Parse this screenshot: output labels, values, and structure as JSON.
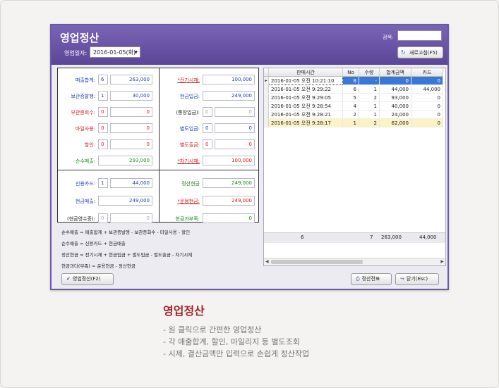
{
  "window": {
    "title": "영업정산",
    "date_label": "영업일자:",
    "date_value": "2016-01-05(화)",
    "search_label": "검색:",
    "search_value": "",
    "refresh_button": "새로고침(F5)"
  },
  "settle": {
    "sales_total": {
      "label": "매출합계:",
      "count": "6",
      "amount": "263,000"
    },
    "refund": {
      "label": "보관증발행:",
      "count": "1",
      "amount": "30,000"
    },
    "receivable": {
      "label": "부관증회수:",
      "count": "0",
      "amount": "0"
    },
    "mileage": {
      "label": "마일사용:",
      "count": "0",
      "amount": "0"
    },
    "discount": {
      "label": "할인:",
      "count": "0",
      "amount": "0"
    },
    "net_sales": {
      "label": "순수매출:",
      "amount": "293,000"
    },
    "prev_cash": {
      "label": "*전기시재:",
      "amount": "100,000"
    },
    "cash_in": {
      "label": "현금입금:",
      "amount": "249,000"
    },
    "exchange_in": {
      "label": "(통장입금):",
      "count": "0",
      "amount": "0"
    },
    "extra_in": {
      "label": "별도입금:",
      "count": "0",
      "amount": "0"
    },
    "extra_out": {
      "label": "별도출금:",
      "count": "0",
      "amount": "0"
    },
    "next_cash": {
      "label": "*차기시재:",
      "amount": "100,000"
    },
    "card": {
      "label": "신용카드:",
      "count": "1",
      "amount": "44,000"
    },
    "cash_sales": {
      "label": "현금매출:",
      "amount": "249,000"
    },
    "cash_receipt": {
      "label": "(현금영수증):",
      "count": "0",
      "amount": "0"
    },
    "settle_cash": {
      "label": "정산현금",
      "amount": "249,000"
    },
    "flow_cash": {
      "label": "*운용현금:",
      "amount": "249,000"
    },
    "cash_diff": {
      "label": "현금과부족:",
      "amount": "0"
    }
  },
  "formulas": [
    "순수매출 = 매출합계 + 보관증발행 - 보관증회수 - 마일사용 - 할인",
    "순수매출 = 신용카드 + 현금매출",
    "정산현금 = 전기시재 + 현금입금 + 별도입금 - 별도출금 - 차기시재",
    "현금과다(부족) = 운용현금 - 정산현금"
  ],
  "grid": {
    "columns": [
      "판매시간",
      "No",
      "수량",
      "합계금액",
      "카드"
    ],
    "rows": [
      {
        "time": "2016-01-05 오전 10:21:10",
        "no": "8",
        "qty": "-",
        "total": "0",
        "card": "0",
        "state": "selected",
        "indicator": "▸"
      },
      {
        "time": "2016-01-05 오전 9:29:22",
        "no": "6",
        "qty": "1",
        "total": "44,000",
        "card": "44,000",
        "state": "",
        "indicator": ""
      },
      {
        "time": "2016-01-05 오전 9:29:05",
        "no": "5",
        "qty": "2",
        "total": "93,000",
        "card": "0",
        "state": "",
        "indicator": ""
      },
      {
        "time": "2016-01-05 오전 9:28:54",
        "no": "4",
        "qty": "1",
        "total": "40,000",
        "card": "0",
        "state": "",
        "indicator": ""
      },
      {
        "time": "2016-01-05 오전 9:28:21",
        "no": "2",
        "qty": "1",
        "total": "24,000",
        "card": "0",
        "state": "",
        "indicator": ""
      },
      {
        "time": "2016-01-05 오전 9:28:17",
        "no": "1",
        "qty": "2",
        "total": "62,000",
        "card": "0",
        "state": "highlight",
        "indicator": ""
      }
    ],
    "summary": {
      "count": "6",
      "qty": "7",
      "total": "263,000",
      "card": "44,000"
    }
  },
  "buttons": {
    "settle": "영업정산(F2)",
    "slip": "정산전표",
    "close": "닫기(Esc)"
  },
  "caption": {
    "title": "영업정산",
    "items": [
      "- 원 클릭으로 간편한 영업정산",
      "- 각 매출합계, 할인, 마일리지 등 별도조회",
      "- 시제, 결산금액만 입력으로 손쉽게 정산작업"
    ]
  }
}
